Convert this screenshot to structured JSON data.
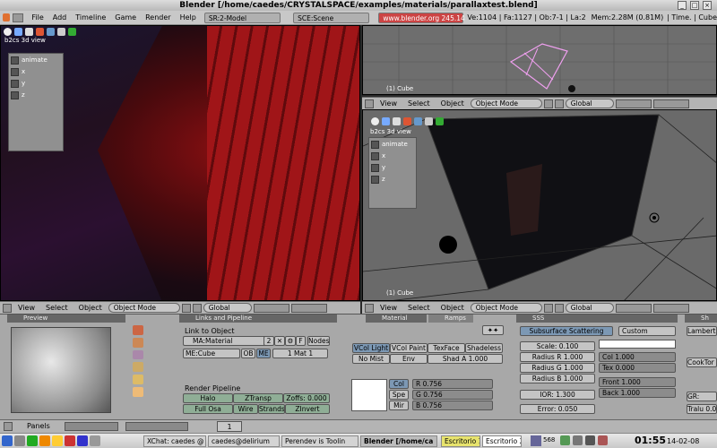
{
  "window": {
    "title": "Blender [/home/caedes/CRYSTALSPACE/examples/materials/parallaxtest.blend]"
  },
  "info": {
    "menus": [
      "File",
      "Add",
      "Timeline",
      "Game",
      "Render",
      "Help"
    ],
    "screen": "SR:2-Model",
    "scene": "SCE:Scene",
    "url": "www.blender.org 245.14",
    "stats": "Ve:1104 | Fa:1127 | Ob:7-1 | La:2",
    "mem": "Mem:2.28M (0.81M)",
    "selection": "| Time. | Cube"
  },
  "viewport": {
    "menu_view": "View",
    "menu_select": "Select",
    "menu_object": "Object",
    "mode": "Object Mode",
    "orient": "Global",
    "b2cs_label": "b2cs 3d view",
    "b2cs_buttons": [
      "animate",
      "x",
      "y",
      "z"
    ],
    "object_label": "(1) Cube"
  },
  "buttons": {
    "preview_title": "Preview",
    "links_title": "Links and Pipeline",
    "material_tab": "Material",
    "ramps_tab": "Ramps",
    "sss_title": "SSS",
    "link_to_object": "Link to Object",
    "ma_field": "MA:Material",
    "ma_users": "2",
    "f_label": "F",
    "nodes_label": "Nodes",
    "me_field": "ME:Cube",
    "ob_label": "OB",
    "me_label": "ME",
    "mat_label": "1 Mat 1",
    "render_pipeline": "Render Pipeline",
    "halo": "Halo",
    "ztransp": "ZTransp",
    "zoffs": "Zoffs: 0.000",
    "full_osa": "Full Osa",
    "wire": "Wire",
    "strands": "Strands",
    "zinvert": "ZInvert",
    "vcol_light": "VCol Light",
    "vcol_paint": "VCol Paint",
    "texface": "TexFace",
    "shadeless": "Shadeless",
    "no_mist": "No Mist",
    "env": "Env",
    "shad_a": "Shad A 1.000",
    "col": "Col",
    "spe": "Spe",
    "mir": "Mir",
    "r": "R 0.756",
    "g": "G 0.756",
    "b": "B 0.756",
    "sss_button": "Subsurface Scattering",
    "custom": "Custom",
    "scale": "Scale: 0.100",
    "radius_r": "Radius R 1.000",
    "radius_g": "Radius G 1.000",
    "radius_b": "Radius B 1.000",
    "ior": "IOR: 1.300",
    "error": "Error: 0.050",
    "col_val": "Col 1.000",
    "tex_val": "Tex 0.000",
    "front": "Front 1.000",
    "back": "Back 1.000",
    "lambert": "Lambert",
    "cooktorr": "CookTor",
    "gr": "GR:",
    "tralu": "Tralu 0.0",
    "shaders_title": "Sh"
  },
  "panels_bar": {
    "label": "Panels",
    "page": "1"
  },
  "taskbar": {
    "tasks": [
      "XChat: caedes @",
      "caedes@delirium",
      "Perendev is Toolin",
      "Blender [/home/ca"
    ],
    "workspace1": "Escritorio 1",
    "workspace2": "Escritorio 2",
    "net": "568",
    "time": "01:55",
    "date": "14-02-08"
  },
  "colors": {
    "accent": "#c8c8c8",
    "active_blue": "#7c98b4",
    "red_scene": "#8a0f12"
  }
}
